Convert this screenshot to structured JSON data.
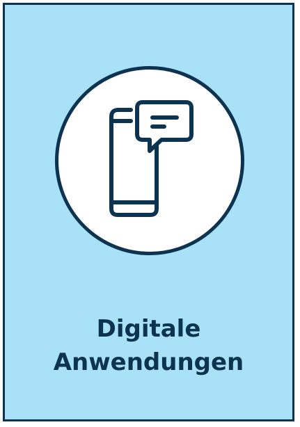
{
  "tile": {
    "title_line1": "Digitale",
    "title_line2": "Anwendungen",
    "icon": "mobile-chat-icon",
    "colors": {
      "background": "#a9e1f8",
      "accent": "#0c3350",
      "circle": "#ffffff"
    }
  }
}
